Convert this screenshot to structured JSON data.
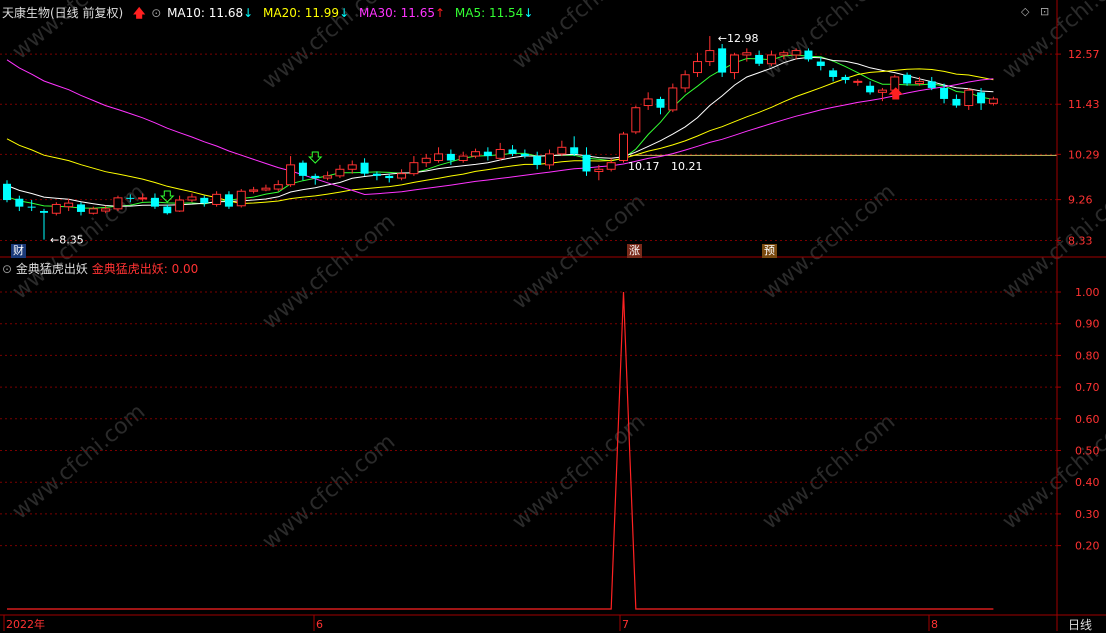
{
  "stock": {
    "name": "天康生物(日线 前复权)",
    "ma10": {
      "label": "MA10: 11.68",
      "color": "#ffffff",
      "dir": "↓"
    },
    "ma20": {
      "label": "MA20: 11.99",
      "color": "#ffff00",
      "dir": "↓"
    },
    "ma30": {
      "label": "MA30: 11.65",
      "color": "#ff33ff",
      "dir": "↑"
    },
    "ma5": {
      "label": "MA5: 11.54",
      "color": "#33ff33",
      "dir": "↓"
    }
  },
  "indicator": {
    "name": "金典猛虎出妖",
    "value_label": "金典猛虎出妖: 0.00"
  },
  "price_axis": [
    "12.57",
    "11.43",
    "10.29",
    "9.26",
    "8.33"
  ],
  "indicator_axis": [
    "1.00",
    "0.90",
    "0.80",
    "0.70",
    "0.60",
    "0.50",
    "0.40",
    "0.30",
    "0.20"
  ],
  "date_axis": [
    "2022年",
    "6",
    "7",
    "8"
  ],
  "period_label": "日线",
  "annotations": {
    "high": "12.98",
    "low": "8.35",
    "mid1": "10.17",
    "mid2": "10.21",
    "tag_cai": "财",
    "tag_zhang": "涨",
    "tag_yu": "预"
  },
  "watermark": "www.cfchi.com",
  "colors": {
    "up": "#ff3232",
    "down": "#00ffff",
    "indicator_line": "#ff2222",
    "grid": "#7a0000",
    "axis_text": "#ff3232"
  },
  "chart_data": {
    "type": "candlestick",
    "ylim": [
      8.0,
      13.3
    ],
    "candles": [
      [
        9.62,
        9.25,
        9.7,
        9.2
      ],
      [
        9.28,
        9.1,
        9.35,
        9.0
      ],
      [
        9.1,
        9.08,
        9.25,
        9.0
      ],
      [
        9.0,
        8.96,
        9.05,
        8.35
      ],
      [
        8.95,
        9.15,
        9.2,
        8.9
      ],
      [
        9.1,
        9.18,
        9.28,
        9.0
      ],
      [
        9.15,
        8.98,
        9.2,
        8.9
      ],
      [
        8.95,
        9.05,
        9.1,
        8.92
      ],
      [
        9.0,
        9.05,
        9.12,
        8.95
      ],
      [
        9.05,
        9.3,
        9.35,
        9.0
      ],
      [
        9.3,
        9.28,
        9.38,
        9.2
      ],
      [
        9.28,
        9.3,
        9.4,
        9.22
      ],
      [
        9.3,
        9.1,
        9.4,
        9.05
      ],
      [
        9.1,
        8.95,
        9.15,
        8.92
      ],
      [
        9.0,
        9.25,
        9.35,
        8.98
      ],
      [
        9.25,
        9.32,
        9.4,
        9.2
      ],
      [
        9.3,
        9.18,
        9.35,
        9.1
      ],
      [
        9.15,
        9.38,
        9.45,
        9.1
      ],
      [
        9.38,
        9.1,
        9.45,
        9.05
      ],
      [
        9.12,
        9.45,
        9.5,
        9.08
      ],
      [
        9.45,
        9.48,
        9.55,
        9.4
      ],
      [
        9.48,
        9.52,
        9.6,
        9.45
      ],
      [
        9.5,
        9.6,
        9.7,
        9.45
      ],
      [
        9.6,
        10.05,
        10.25,
        9.55
      ],
      [
        10.1,
        9.8,
        10.15,
        9.7
      ],
      [
        9.8,
        9.75,
        9.85,
        9.6
      ],
      [
        9.75,
        9.8,
        9.9,
        9.7
      ],
      [
        9.8,
        9.95,
        10.05,
        9.75
      ],
      [
        9.95,
        10.05,
        10.15,
        9.85
      ],
      [
        10.1,
        9.85,
        10.2,
        9.8
      ],
      [
        9.85,
        9.8,
        9.9,
        9.7
      ],
      [
        9.8,
        9.75,
        9.85,
        9.65
      ],
      [
        9.75,
        9.85,
        9.95,
        9.7
      ],
      [
        9.85,
        10.1,
        10.25,
        9.8
      ],
      [
        10.1,
        10.2,
        10.3,
        10.0
      ],
      [
        10.15,
        10.3,
        10.45,
        10.1
      ],
      [
        10.3,
        10.15,
        10.4,
        10.05
      ],
      [
        10.15,
        10.25,
        10.35,
        10.1
      ],
      [
        10.25,
        10.35,
        10.42,
        10.2
      ],
      [
        10.35,
        10.25,
        10.45,
        10.15
      ],
      [
        10.2,
        10.4,
        10.55,
        10.15
      ],
      [
        10.4,
        10.3,
        10.5,
        10.25
      ],
      [
        10.3,
        10.25,
        10.4,
        10.2
      ],
      [
        10.25,
        10.05,
        10.35,
        9.95
      ],
      [
        10.05,
        10.3,
        10.4,
        9.95
      ],
      [
        10.3,
        10.45,
        10.6,
        10.25
      ],
      [
        10.45,
        10.3,
        10.7,
        10.25
      ],
      [
        10.28,
        9.9,
        10.45,
        9.8
      ],
      [
        9.9,
        9.95,
        10.05,
        9.7
      ],
      [
        9.95,
        10.1,
        10.2,
        9.9
      ],
      [
        10.15,
        10.75,
        10.8,
        10.1
      ],
      [
        10.8,
        11.35,
        11.4,
        10.75
      ],
      [
        11.4,
        11.55,
        11.7,
        11.3
      ],
      [
        11.55,
        11.35,
        11.6,
        11.2
      ],
      [
        11.3,
        11.8,
        11.9,
        11.25
      ],
      [
        11.8,
        12.1,
        12.2,
        11.7
      ],
      [
        12.15,
        12.4,
        12.6,
        12.05
      ],
      [
        12.4,
        12.65,
        12.98,
        12.3
      ],
      [
        12.7,
        12.15,
        12.8,
        12.05
      ],
      [
        12.15,
        12.55,
        12.6,
        12.0
      ],
      [
        12.55,
        12.6,
        12.7,
        12.4
      ],
      [
        12.55,
        12.35,
        12.65,
        12.3
      ],
      [
        12.35,
        12.55,
        12.65,
        12.3
      ],
      [
        12.55,
        12.6,
        12.65,
        12.45
      ],
      [
        12.55,
        12.65,
        12.7,
        12.45
      ],
      [
        12.65,
        12.45,
        12.7,
        12.4
      ],
      [
        12.4,
        12.3,
        12.5,
        12.2
      ],
      [
        12.2,
        12.05,
        12.25,
        11.95
      ],
      [
        12.05,
        11.98,
        12.1,
        11.9
      ],
      [
        11.95,
        11.95,
        12.0,
        11.85
      ],
      [
        11.85,
        11.7,
        11.95,
        11.65
      ],
      [
        11.7,
        11.75,
        11.8,
        11.5
      ],
      [
        11.75,
        12.05,
        12.1,
        11.7
      ],
      [
        12.1,
        11.9,
        12.15,
        11.85
      ],
      [
        11.9,
        11.95,
        12.05,
        11.85
      ],
      [
        11.95,
        11.8,
        12.05,
        11.75
      ],
      [
        11.8,
        11.55,
        11.9,
        11.45
      ],
      [
        11.55,
        11.4,
        11.65,
        11.35
      ],
      [
        11.4,
        11.75,
        11.8,
        11.3
      ],
      [
        11.7,
        11.45,
        11.8,
        11.3
      ],
      [
        11.45,
        11.55,
        11.6,
        11.4
      ]
    ],
    "indicator": {
      "name": "金典猛虎出妖",
      "ylim": [
        0,
        1.06
      ],
      "spike_index": 50,
      "value": 1.0
    }
  }
}
